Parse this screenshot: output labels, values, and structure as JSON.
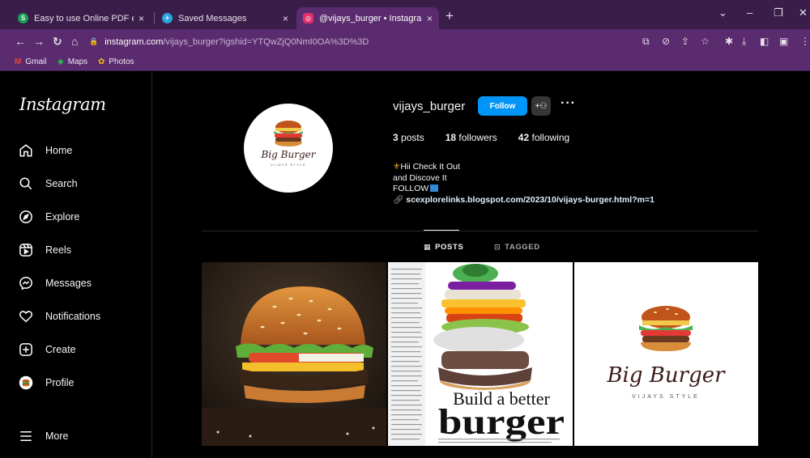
{
  "browser": {
    "tabs": [
      {
        "title": "Easy to use Online PDF editor",
        "favicon_letter": "S",
        "favicon_color": "#18a058"
      },
      {
        "title": "Saved Messages",
        "favicon_letter": "✈",
        "favicon_color": "#2aa3e0"
      },
      {
        "title": "@vijays_burger • Instagram pho",
        "favicon_letter": "◎",
        "favicon_color": "#e1306c"
      }
    ],
    "tab_close": "×",
    "new_tab": "+",
    "url_host": "instagram.com",
    "url_path": "/vijays_burger?igshid=YTQwZjQ0NmI0OA%3D%3D",
    "bookmarks": [
      {
        "label": "Gmail",
        "icon": "M",
        "color": "#ea4335"
      },
      {
        "label": "Maps",
        "icon": "◆",
        "color": "#34a853"
      },
      {
        "label": "Photos",
        "icon": "✿",
        "color": "#fbbc04"
      }
    ]
  },
  "instagram": {
    "logo": "Instagram",
    "nav": [
      {
        "label": "Home",
        "icon": "home-icon"
      },
      {
        "label": "Search",
        "icon": "search-icon"
      },
      {
        "label": "Explore",
        "icon": "compass-icon"
      },
      {
        "label": "Reels",
        "icon": "reels-icon"
      },
      {
        "label": "Messages",
        "icon": "messenger-icon"
      },
      {
        "label": "Notifications",
        "icon": "heart-icon"
      },
      {
        "label": "Create",
        "icon": "plus-square-icon"
      },
      {
        "label": "Profile",
        "icon": "profile-avatar-icon"
      },
      {
        "label": "More",
        "icon": "hamburger-icon"
      }
    ],
    "profile": {
      "username": "vijays_burger",
      "follow_label": "Follow",
      "posts_count": "3",
      "posts_label": "posts",
      "followers_count": "18",
      "followers_label": "followers",
      "following_count": "42",
      "following_label": "following",
      "bio_line1": "Hii Check It Out",
      "bio_line2": "and Discove It",
      "bio_line3": "FOLLOW",
      "bio_link": "scexplorelinks.blogspot.com/2023/10/vijays-burger.html?m=1",
      "avatar_brand": "Big Burger",
      "avatar_sub": "VIJAYS STYLE"
    },
    "tabs": {
      "posts": "POSTS",
      "tagged": "TAGGED"
    },
    "posts": [
      {
        "kind": "burger-photo"
      },
      {
        "kind": "magazine",
        "headline1": "Build a better",
        "headline2": "burger"
      },
      {
        "kind": "logo",
        "brand": "Big Burger",
        "sub": "VIJAYS STYLE"
      }
    ]
  }
}
